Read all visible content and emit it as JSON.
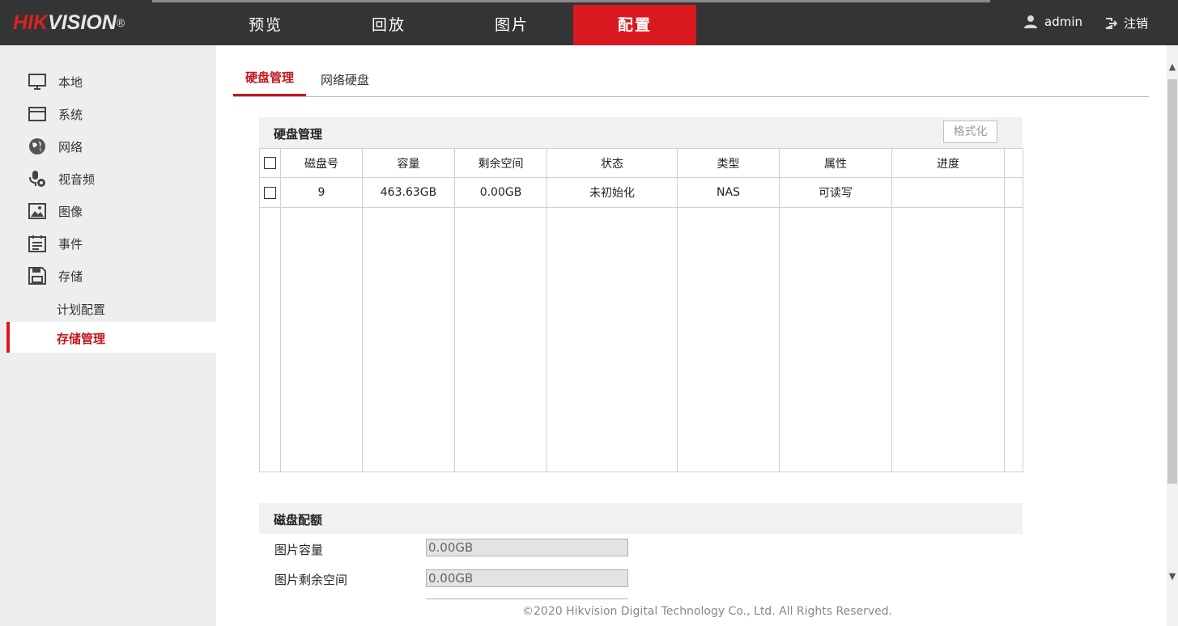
{
  "header": {
    "logo_red": "HIK",
    "logo_light": "VISION",
    "logo_mark": "®",
    "nav": [
      "预览",
      "回放",
      "图片",
      "配置"
    ],
    "user_name": "admin",
    "logout_label": "注销"
  },
  "sidebar": {
    "items": [
      {
        "label": "本地",
        "icon": "monitor-icon"
      },
      {
        "label": "系统",
        "icon": "window-icon"
      },
      {
        "label": "网络",
        "icon": "globe-icon"
      },
      {
        "label": "视音频",
        "icon": "mic-camera-icon"
      },
      {
        "label": "图像",
        "icon": "image-icon"
      },
      {
        "label": "事件",
        "icon": "calendar-list-icon"
      },
      {
        "label": "存储",
        "icon": "floppy-disk-icon"
      }
    ],
    "sub_items": [
      "计划配置",
      "存储管理"
    ]
  },
  "tabs": [
    "硬盘管理",
    "网络硬盘"
  ],
  "disk_panel": {
    "title": "硬盘管理",
    "format_button": "格式化",
    "columns": [
      "磁盘号",
      "容量",
      "剩余空间",
      "状态",
      "类型",
      "属性",
      "进度"
    ],
    "rows": [
      {
        "disk_no": "9",
        "capacity": "463.63GB",
        "free": "0.00GB",
        "status": "未初始化",
        "type": "NAS",
        "attribute": "可读写",
        "progress": ""
      }
    ]
  },
  "quota_panel": {
    "title": "磁盘配额",
    "picture_capacity_label": "图片容量",
    "picture_capacity_value": "0.00GB",
    "picture_free_label": "图片剩余空间",
    "picture_free_value": "0.00GB"
  },
  "footer": "©2020 Hikvision Digital Technology Co., Ltd. All Rights Reserved.",
  "colors": {
    "accent": "#d9191f",
    "topbar": "#333435",
    "sidebar": "#eeeeee"
  }
}
